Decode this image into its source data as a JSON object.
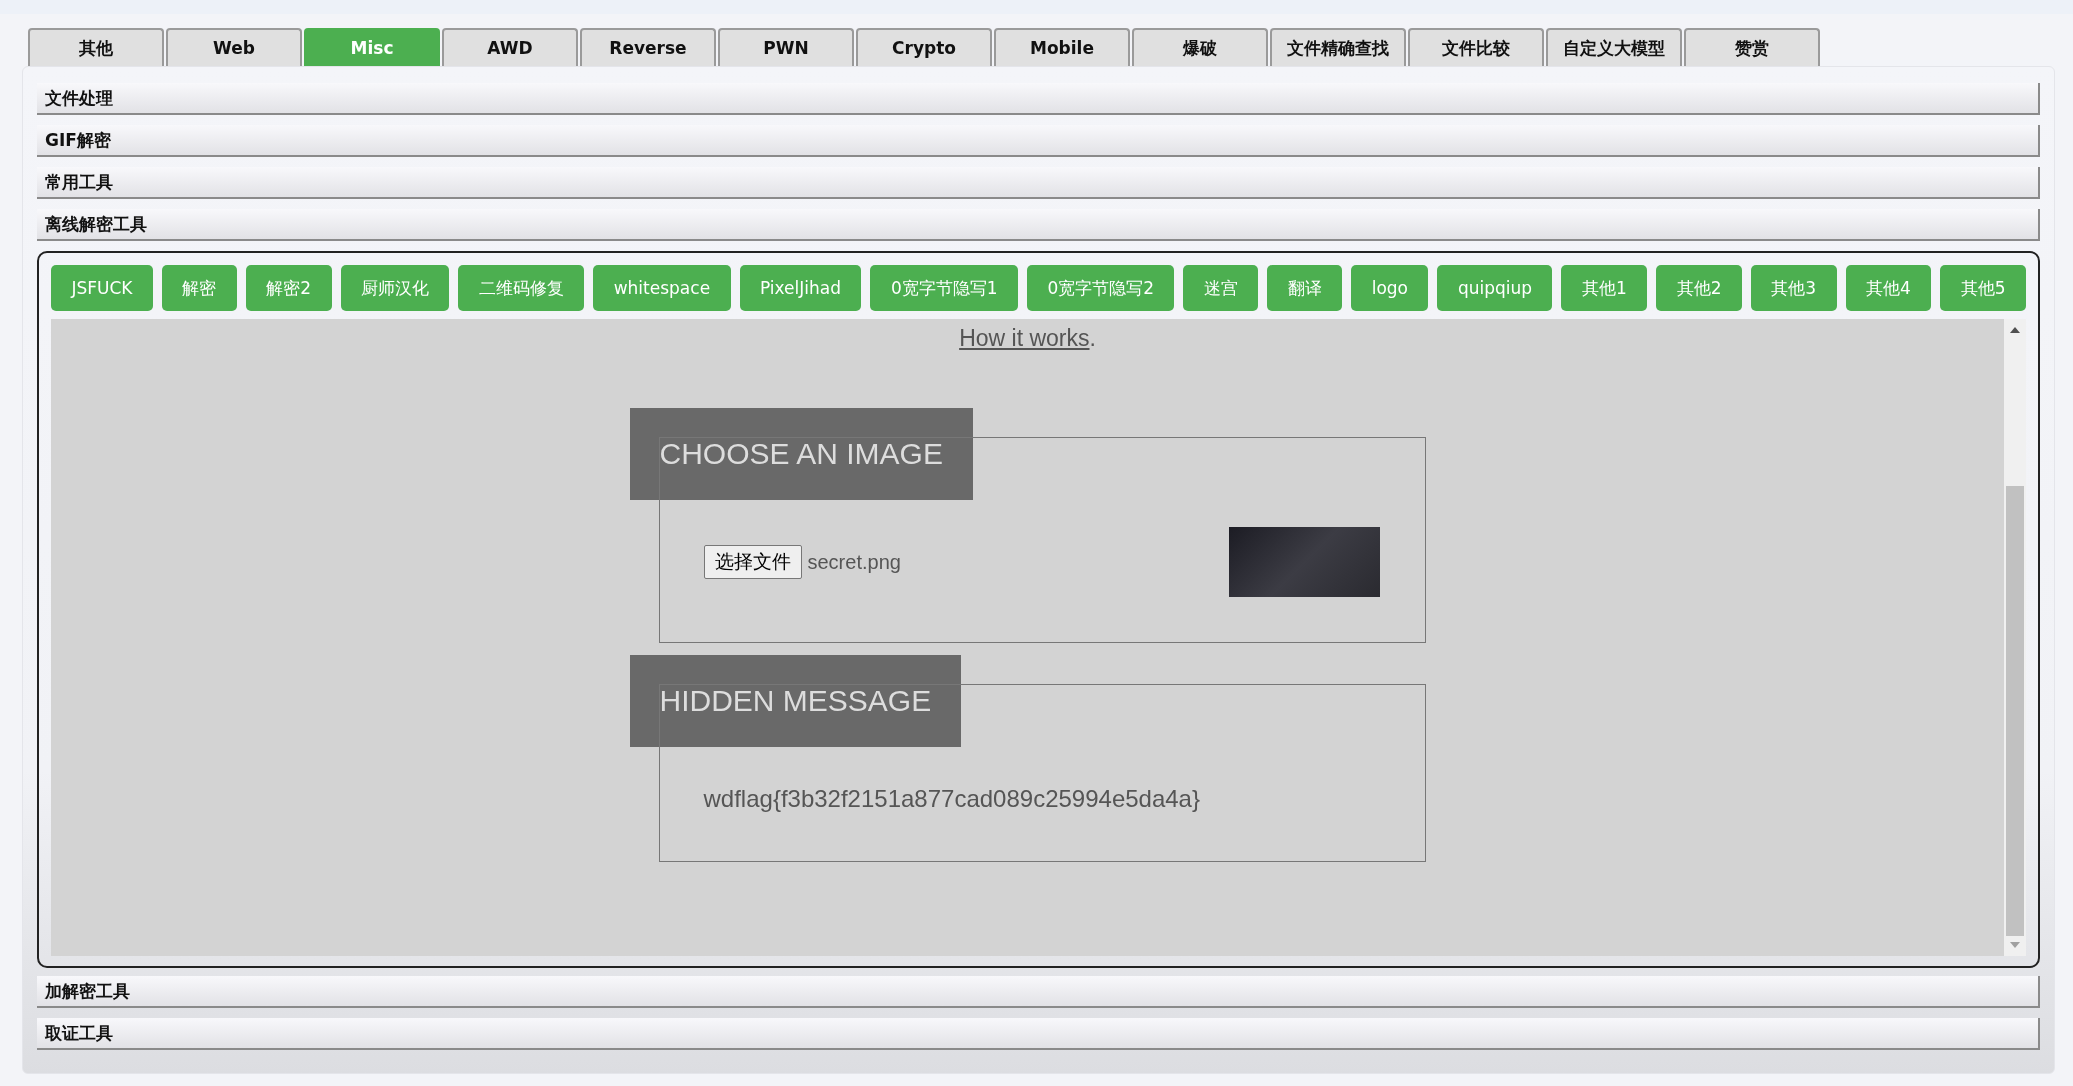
{
  "tabs": [
    {
      "label": "其他",
      "selected": false
    },
    {
      "label": "Web",
      "selected": false
    },
    {
      "label": "Misc",
      "selected": true
    },
    {
      "label": "AWD",
      "selected": false
    },
    {
      "label": "Reverse",
      "selected": false
    },
    {
      "label": "PWN",
      "selected": false
    },
    {
      "label": "Crypto",
      "selected": false
    },
    {
      "label": "Mobile",
      "selected": false
    },
    {
      "label": "爆破",
      "selected": false
    },
    {
      "label": "文件精确查找",
      "selected": false
    },
    {
      "label": "文件比较",
      "selected": false
    },
    {
      "label": "自定义大模型",
      "selected": false
    },
    {
      "label": "赞赏",
      "selected": false
    }
  ],
  "sections": [
    {
      "title": "文件处理"
    },
    {
      "title": "GIF解密"
    },
    {
      "title": "常用工具"
    },
    {
      "title": "离线解密工具",
      "tools": [
        "JSFUCK",
        "解密",
        "解密2",
        "厨师汉化",
        "二维码修复",
        "whitespace",
        "PixelJihad",
        "0宽字节隐写1",
        "0宽字节隐写2",
        "迷宫",
        "翻译",
        "logo",
        "quipqiup",
        "其他1",
        "其他2",
        "其他3",
        "其他4",
        "其他5"
      ],
      "tool_page": {
        "intro_link": "How it works",
        "intro_end": ".",
        "choose": {
          "heading": "CHOOSE AN IMAGE",
          "file_button": "选择文件",
          "file_name": "secret.png"
        },
        "hidden": {
          "heading": "HIDDEN MESSAGE",
          "message": "wdflag{f3b32f2151a877cad089c25994e5da4a}"
        }
      }
    },
    {
      "title": "加解密工具"
    },
    {
      "title": "取证工具"
    }
  ]
}
